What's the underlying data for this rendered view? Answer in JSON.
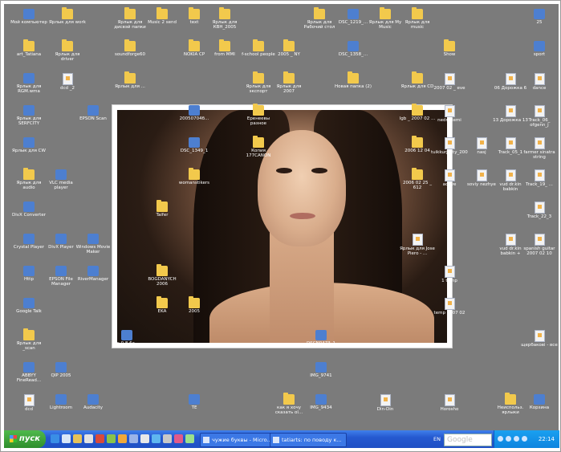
{
  "desktop": {
    "icons": [
      {
        "label": "Мой компьютер",
        "type": "app"
      },
      {
        "label": "Ярлык для work",
        "type": "folder"
      },
      {
        "label": "Ярлык для дисвэй папки",
        "type": "folder"
      },
      {
        "label": "Music 2 send",
        "type": "folder"
      },
      {
        "label": "text",
        "type": "folder"
      },
      {
        "label": "Ярлык для КВН_2005",
        "type": "folder"
      },
      {
        "label": "Ярлык для Рабочий стол",
        "type": "folder"
      },
      {
        "label": "DSC_1219_...",
        "type": "app"
      },
      {
        "label": "Ярлык для My Music",
        "type": "folder"
      },
      {
        "label": "Ярлык для music",
        "type": "folder"
      },
      {
        "label": "25",
        "type": "app"
      },
      {
        "label": "art_Tatiana",
        "type": "folder"
      },
      {
        "label": "Ярлык для driver",
        "type": "folder"
      },
      {
        "label": "soundforge60",
        "type": "folder"
      },
      {
        "label": "NOKIA CP",
        "type": "folder"
      },
      {
        "label": "from MMI",
        "type": "folder"
      },
      {
        "label": "f-school people",
        "type": "folder"
      },
      {
        "label": "2005 _ NY",
        "type": "folder"
      },
      {
        "label": "DSC_1358_...",
        "type": "app"
      },
      {
        "label": "Show",
        "type": "folder"
      },
      {
        "label": "sport",
        "type": "app"
      },
      {
        "label": "Ярлык для RGM.wma",
        "type": "app"
      },
      {
        "label": "dcd _2",
        "type": "file"
      },
      {
        "label": "Ярлык для ...",
        "type": "folder"
      },
      {
        "label": "Ярлык для экспорт",
        "type": "folder"
      },
      {
        "label": "Ярлык для 2007",
        "type": "folder"
      },
      {
        "label": "Новая папка (2)",
        "type": "folder"
      },
      {
        "label": "Ярлык для CD",
        "type": "folder"
      },
      {
        "label": "2007 02 _ eve",
        "type": "file"
      },
      {
        "label": "06 Дорожка 6",
        "type": "file"
      },
      {
        "label": "dance",
        "type": "file"
      },
      {
        "label": "Ярлык для SERFCITY",
        "type": "app"
      },
      {
        "label": "EPSON Scan",
        "type": "app"
      },
      {
        "label": "20050704б...",
        "type": "app"
      },
      {
        "label": "Еренеевы разное",
        "type": "folder"
      },
      {
        "label": "lgb _ 2007 02 ...",
        "type": "folder"
      },
      {
        "label": "nedredemi",
        "type": "file"
      },
      {
        "label": "13 Дорожка 13",
        "type": "file"
      },
      {
        "label": "Track_06_ ofgenn_j",
        "type": "file"
      },
      {
        "label": "Ярлык для CW",
        "type": "app"
      },
      {
        "label": "DSC_1349_1",
        "type": "app"
      },
      {
        "label": "Копия 177CANON",
        "type": "folder"
      },
      {
        "label": "2006 12 04",
        "type": "folder"
      },
      {
        "label": "tuikkurjacty_2005",
        "type": "file"
      },
      {
        "label": "nasj",
        "type": "file"
      },
      {
        "label": "Track_05_1",
        "type": "file"
      },
      {
        "label": "farmer sinatra string",
        "type": "file"
      },
      {
        "label": "Ярлык для audio",
        "type": "folder"
      },
      {
        "label": "VLC media player",
        "type": "app"
      },
      {
        "label": "womanstikers",
        "type": "folder"
      },
      {
        "label": "2006 02 25 _ 612",
        "type": "folder"
      },
      {
        "label": "active",
        "type": "file"
      },
      {
        "label": "soviy nezhye",
        "type": "file"
      },
      {
        "label": "vud dr.kin babkin",
        "type": "file"
      },
      {
        "label": "Track_19_ ...",
        "type": "file"
      },
      {
        "label": "DivX Converter",
        "type": "app"
      },
      {
        "label": "Taifer",
        "type": "folder"
      },
      {
        "label": "Track_22_3",
        "type": "file"
      },
      {
        "label": "Crystal Player",
        "type": "app"
      },
      {
        "label": "DivX Player",
        "type": "app"
      },
      {
        "label": "Windows Movie Maker",
        "type": "app"
      },
      {
        "label": "Ярлык для Jose Piero - ...",
        "type": "file"
      },
      {
        "label": "vud dr.kin babkin +",
        "type": "file"
      },
      {
        "label": "spanish guitar 2007 02 10",
        "type": "file"
      },
      {
        "label": "Http",
        "type": "app"
      },
      {
        "label": "EPSON File Manager",
        "type": "app"
      },
      {
        "label": "RiverManager",
        "type": "app"
      },
      {
        "label": "BOGDANYCH 2006",
        "type": "folder"
      },
      {
        "label": "1 temp",
        "type": "file"
      },
      {
        "label": "Google Talk",
        "type": "app"
      },
      {
        "label": "EKA",
        "type": "folder"
      },
      {
        "label": "2005",
        "type": "folder"
      },
      {
        "label": "temp 2007 02 15",
        "type": "file"
      },
      {
        "label": "Ярлык для _scan",
        "type": "folder"
      },
      {
        "label": "vlc-0.8.6a-...",
        "type": "app"
      },
      {
        "label": "DSCN0473_1",
        "type": "app"
      },
      {
        "label": "щербакові - все",
        "type": "file"
      },
      {
        "label": "ABBYY FineRead...",
        "type": "app"
      },
      {
        "label": "QIP 2005",
        "type": "app"
      },
      {
        "label": "IMG_9741",
        "type": "app"
      },
      {
        "label": "dcd",
        "type": "file"
      },
      {
        "label": "Lightroom",
        "type": "app"
      },
      {
        "label": "Audacity",
        "type": "app"
      },
      {
        "label": "TE",
        "type": "app"
      },
      {
        "label": "как я хочу сказать ol...",
        "type": "folder"
      },
      {
        "label": "IMG_9434",
        "type": "app"
      },
      {
        "label": "Din-Din",
        "type": "file"
      },
      {
        "label": "Horosho",
        "type": "file"
      },
      {
        "label": "Неиспольз. ярлыки",
        "type": "folder"
      },
      {
        "label": "Корзина",
        "type": "app"
      }
    ]
  },
  "taskbar": {
    "start_label": "пуск",
    "tasks": [
      {
        "label": "чужие буквы - Micro..."
      },
      {
        "label": "tatiarts: по поводу к..."
      }
    ],
    "language": "EN",
    "search_placeholder": "Google",
    "clock": "22:14"
  },
  "colors": {
    "desktop_bg": "#7b7b7b",
    "taskbar": "#2559d0",
    "start_button": "#2f8e2c",
    "tray": "#0e84df"
  }
}
